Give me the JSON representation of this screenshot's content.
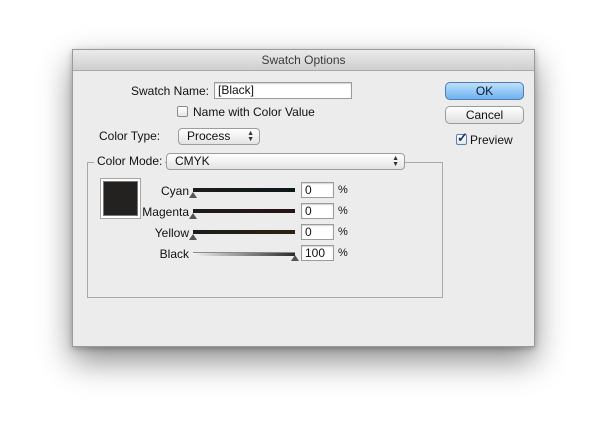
{
  "window": {
    "title": "Swatch Options"
  },
  "swatch_name": {
    "label": "Swatch Name:",
    "value": "[Black]"
  },
  "name_with_color_value": {
    "label": "Name with Color Value",
    "checked": false
  },
  "color_type": {
    "label": "Color Type:",
    "value": "Process"
  },
  "color_mode": {
    "label": "Color Mode:",
    "value": "CMYK"
  },
  "channels": [
    {
      "label": "Cyan",
      "value": "0",
      "unit": "%"
    },
    {
      "label": "Magenta",
      "value": "0",
      "unit": "%"
    },
    {
      "label": "Yellow",
      "value": "0",
      "unit": "%"
    },
    {
      "label": "Black",
      "value": "100",
      "unit": "%"
    }
  ],
  "buttons": {
    "ok": "OK",
    "cancel": "Cancel"
  },
  "preview": {
    "label": "Preview",
    "checked": true
  },
  "icons": {
    "popup_arrows": "updown-arrows-icon",
    "checkmark": "checkmark-icon",
    "slider_thumb": "triangle-thumb-icon"
  },
  "colors": {
    "swatch": "#232220",
    "default_button": "#6fb2ef"
  }
}
